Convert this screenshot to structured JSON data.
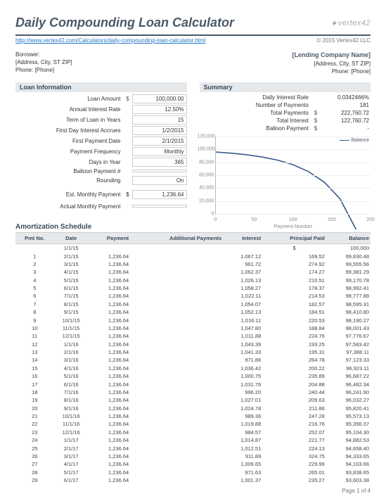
{
  "header": {
    "title": "Daily Compounding Loan Calculator",
    "logo_text": "vertex42",
    "link": "http://www.vertex42.com/Calculators/daily-compounding-loan-calculator.html",
    "copyright": "© 2015 Vertex42 LLC"
  },
  "borrower": {
    "label": "Borrower:",
    "address": "[Address, City, ST  ZIP]",
    "phone": "Phone: [Phone]"
  },
  "lender": {
    "name": "[Lending Company Name]",
    "address": "[Address, City, ST  ZIP]",
    "phone": "Phone: [Phone]"
  },
  "loan_info": {
    "title": "Loan Information",
    "rows": [
      {
        "label": "Loan Amount",
        "sym": "$",
        "value": "100,000.00",
        "boxed": true
      },
      {
        "label": "Annual Interest Rate",
        "sym": "",
        "value": "12.50%",
        "boxed": true
      },
      {
        "label": "Term of Loan in Years",
        "sym": "",
        "value": "15",
        "boxed": true
      },
      {
        "label": "First Day Interest Accrues",
        "sym": "",
        "value": "1/2/2015",
        "boxed": true
      },
      {
        "label": "First Payment Date",
        "sym": "",
        "value": "2/1/2015",
        "boxed": true
      },
      {
        "label": "Payment Frequency",
        "sym": "",
        "value": "Monthly",
        "boxed": true
      },
      {
        "label": "Days in Year",
        "sym": "",
        "value": "365",
        "boxed": true
      },
      {
        "label": "Balloon Payment #",
        "sym": "",
        "value": "",
        "boxed": true
      },
      {
        "label": "Rounding",
        "sym": "",
        "value": "On",
        "boxed": true
      }
    ],
    "est_label": "Est. Monthly Payment",
    "est_sym": "$",
    "est_value": "1,236.64",
    "actual_label": "Actual Monthly Payment",
    "actual_value": ""
  },
  "summary": {
    "title": "Summary",
    "rows": [
      {
        "label": "Daily Interest Rate",
        "sym": "",
        "value": "0.0342466%"
      },
      {
        "label": "Number of Payments",
        "sym": "",
        "value": "181"
      },
      {
        "label": "Total Payments",
        "sym": "$",
        "value": "222,760.72"
      },
      {
        "label": "Total Interest",
        "sym": "$",
        "value": "122,760.72"
      },
      {
        "label": "Balloon Payment",
        "sym": "$",
        "value": "-"
      }
    ]
  },
  "chart_data": {
    "type": "line",
    "title": "",
    "xlabel": "Payment Number",
    "ylabel": "",
    "ylim": [
      0,
      120000
    ],
    "xlim": [
      0,
      200
    ],
    "yticks": [
      0,
      20000,
      40000,
      60000,
      80000,
      100000,
      120000
    ],
    "xticks": [
      0,
      50,
      100,
      150,
      200
    ],
    "series": [
      {
        "name": "Balance",
        "x": [
          0,
          20,
          40,
          60,
          80,
          100,
          120,
          140,
          160,
          181
        ],
        "y": [
          100000,
          98500,
          96500,
          93500,
          89500,
          83500,
          74500,
          61000,
          40000,
          0
        ]
      }
    ],
    "legend": "Balance"
  },
  "amortization": {
    "title": "Amortization Schedule",
    "headers": [
      "Pmt No.",
      "Date",
      "Payment",
      "Additional Payments",
      "Interest",
      "Principal Paid",
      "Balance"
    ],
    "start_row": {
      "date": "1/1/15",
      "sym": "$",
      "balance": "100,000"
    },
    "rows": [
      {
        "no": "1",
        "date": "2/1/15",
        "payment": "1,236.64",
        "additional": "",
        "interest": "1,067.12",
        "principal": "169.52",
        "balance": "99,830.48"
      },
      {
        "no": "2",
        "date": "3/1/15",
        "payment": "1,236.64",
        "additional": "",
        "interest": "961.72",
        "principal": "274.92",
        "balance": "99,555.56"
      },
      {
        "no": "3",
        "date": "4/1/15",
        "payment": "1,236.64",
        "additional": "",
        "interest": "1,062.37",
        "principal": "174.27",
        "balance": "99,381.29"
      },
      {
        "no": "4",
        "date": "5/1/15",
        "payment": "1,236.64",
        "additional": "",
        "interest": "1,026.13",
        "principal": "210.51",
        "balance": "99,170.78"
      },
      {
        "no": "5",
        "date": "6/1/15",
        "payment": "1,236.64",
        "additional": "",
        "interest": "1,058.27",
        "principal": "178.37",
        "balance": "98,992.41"
      },
      {
        "no": "6",
        "date": "7/1/15",
        "payment": "1,236.64",
        "additional": "",
        "interest": "1,022.11",
        "principal": "214.53",
        "balance": "98,777.88"
      },
      {
        "no": "7",
        "date": "8/1/15",
        "payment": "1,236.64",
        "additional": "",
        "interest": "1,054.07",
        "principal": "182.57",
        "balance": "98,595.31"
      },
      {
        "no": "8",
        "date": "9/1/15",
        "payment": "1,236.64",
        "additional": "",
        "interest": "1,052.13",
        "principal": "184.51",
        "balance": "98,410.80"
      },
      {
        "no": "9",
        "date": "10/1/15",
        "payment": "1,236.64",
        "additional": "",
        "interest": "1,016.11",
        "principal": "220.53",
        "balance": "98,190.27"
      },
      {
        "no": "10",
        "date": "11/1/15",
        "payment": "1,236.64",
        "additional": "",
        "interest": "1,047.80",
        "principal": "188.84",
        "balance": "98,001.43"
      },
      {
        "no": "11",
        "date": "12/1/15",
        "payment": "1,236.64",
        "additional": "",
        "interest": "1,011.88",
        "principal": "224.76",
        "balance": "97,776.67"
      },
      {
        "no": "12",
        "date": "1/1/16",
        "payment": "1,236.64",
        "additional": "",
        "interest": "1,043.39",
        "principal": "193.25",
        "balance": "97,583.42"
      },
      {
        "no": "13",
        "date": "2/1/16",
        "payment": "1,236.64",
        "additional": "",
        "interest": "1,041.33",
        "principal": "195.31",
        "balance": "97,388.11"
      },
      {
        "no": "14",
        "date": "3/1/16",
        "payment": "1,236.64",
        "additional": "",
        "interest": "971.86",
        "principal": "264.78",
        "balance": "97,123.33"
      },
      {
        "no": "15",
        "date": "4/1/16",
        "payment": "1,236.64",
        "additional": "",
        "interest": "1,036.42",
        "principal": "200.22",
        "balance": "96,923.11"
      },
      {
        "no": "16",
        "date": "5/1/16",
        "payment": "1,236.64",
        "additional": "",
        "interest": "1,000.75",
        "principal": "235.89",
        "balance": "96,687.22"
      },
      {
        "no": "17",
        "date": "6/1/16",
        "payment": "1,236.64",
        "additional": "",
        "interest": "1,031.76",
        "principal": "204.88",
        "balance": "96,482.34"
      },
      {
        "no": "18",
        "date": "7/1/16",
        "payment": "1,236.64",
        "additional": "",
        "interest": "996.20",
        "principal": "240.44",
        "balance": "96,241.90"
      },
      {
        "no": "19",
        "date": "8/1/16",
        "payment": "1,236.64",
        "additional": "",
        "interest": "1,027.01",
        "principal": "209.63",
        "balance": "96,032.27"
      },
      {
        "no": "20",
        "date": "9/1/16",
        "payment": "1,236.64",
        "additional": "",
        "interest": "1,024.78",
        "principal": "211.86",
        "balance": "95,820.41"
      },
      {
        "no": "21",
        "date": "10/1/16",
        "payment": "1,236.64",
        "additional": "",
        "interest": "989.36",
        "principal": "247.28",
        "balance": "95,573.13"
      },
      {
        "no": "22",
        "date": "11/1/16",
        "payment": "1,236.64",
        "additional": "",
        "interest": "1,019.88",
        "principal": "216.76",
        "balance": "95,356.37"
      },
      {
        "no": "23",
        "date": "12/1/16",
        "payment": "1,236.64",
        "additional": "",
        "interest": "984.57",
        "principal": "252.07",
        "balance": "95,104.30"
      },
      {
        "no": "24",
        "date": "1/1/17",
        "payment": "1,236.64",
        "additional": "",
        "interest": "1,014.87",
        "principal": "221.77",
        "balance": "94,882.53"
      },
      {
        "no": "25",
        "date": "2/1/17",
        "payment": "1,236.64",
        "additional": "",
        "interest": "1,012.51",
        "principal": "224.13",
        "balance": "94,658.40"
      },
      {
        "no": "26",
        "date": "3/1/17",
        "payment": "1,236.64",
        "additional": "",
        "interest": "911.89",
        "principal": "324.75",
        "balance": "94,333.65"
      },
      {
        "no": "27",
        "date": "4/1/17",
        "payment": "1,236.64",
        "additional": "",
        "interest": "1,006.65",
        "principal": "229.99",
        "balance": "94,103.66"
      },
      {
        "no": "28",
        "date": "5/1/17",
        "payment": "1,236.64",
        "additional": "",
        "interest": "971.63",
        "principal": "265.01",
        "balance": "93,838.65"
      },
      {
        "no": "29",
        "date": "6/1/17",
        "payment": "1,236.64",
        "additional": "",
        "interest": "1,001.37",
        "principal": "235.27",
        "balance": "93,603.38"
      }
    ]
  },
  "footer": "Page 1 of 4"
}
